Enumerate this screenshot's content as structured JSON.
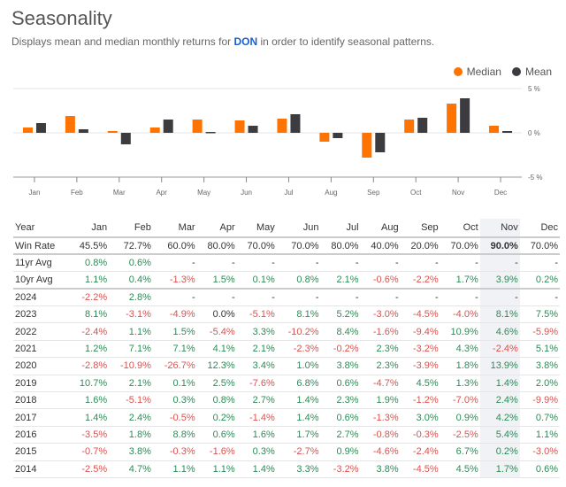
{
  "header": {
    "title": "Seasonality",
    "subtitle_prefix": "Displays mean and median monthly returns for ",
    "ticker": "DON",
    "subtitle_suffix": " in order to identify seasonal patterns."
  },
  "legend": [
    {
      "label": "Median",
      "color": "#ff7300"
    },
    {
      "label": "Mean",
      "color": "#3b3b40"
    }
  ],
  "chart_data": {
    "type": "bar",
    "categories": [
      "Jan",
      "Feb",
      "Mar",
      "Apr",
      "May",
      "Jun",
      "Jul",
      "Aug",
      "Sep",
      "Oct",
      "Nov",
      "Dec"
    ],
    "series": [
      {
        "name": "Median",
        "color": "#ff7300",
        "values": [
          0.6,
          1.9,
          0.2,
          0.6,
          1.5,
          1.4,
          1.6,
          -1.0,
          -2.8,
          1.5,
          3.3,
          0.8
        ]
      },
      {
        "name": "Mean",
        "color": "#3b3b40",
        "values": [
          1.1,
          0.4,
          -1.3,
          1.5,
          0.1,
          0.8,
          2.1,
          -0.6,
          -2.2,
          1.7,
          3.9,
          0.2
        ]
      }
    ],
    "ylim": [
      -5,
      5
    ],
    "yticks": [
      "5 %",
      "0 %",
      "-5 %"
    ],
    "ytick_values": [
      5,
      0,
      -5
    ],
    "legend_position": "top-right",
    "grid": true
  },
  "table": {
    "highlight_column": "Nov",
    "headers": [
      "Year",
      "Jan",
      "Feb",
      "Mar",
      "Apr",
      "May",
      "Jun",
      "Jul",
      "Aug",
      "Sep",
      "Oct",
      "Nov",
      "Dec"
    ],
    "rows": [
      {
        "label": "Win Rate",
        "kind": "winrate",
        "cells": [
          "45.5%",
          "72.7%",
          "60.0%",
          "80.0%",
          "70.0%",
          "70.0%",
          "80.0%",
          "40.0%",
          "20.0%",
          "70.0%",
          "90.0%",
          "70.0%"
        ]
      },
      {
        "label": "11yr Avg",
        "kind": "avg11",
        "cells": [
          "0.8%",
          "0.6%",
          "-",
          "-",
          "-",
          "-",
          "-",
          "-",
          "-",
          "-",
          "-",
          "-"
        ]
      },
      {
        "label": "10yr Avg",
        "kind": "avg10",
        "cells": [
          "1.1%",
          "0.4%",
          "-1.3%",
          "1.5%",
          "0.1%",
          "0.8%",
          "2.1%",
          "-0.6%",
          "-2.2%",
          "1.7%",
          "3.9%",
          "0.2%"
        ]
      },
      {
        "label": "2024",
        "kind": "year",
        "cells": [
          "-2.2%",
          "2.8%",
          "-",
          "-",
          "-",
          "-",
          "-",
          "-",
          "-",
          "-",
          "-",
          "-"
        ]
      },
      {
        "label": "2023",
        "kind": "year",
        "cells": [
          "8.1%",
          "-3.1%",
          "-4.9%",
          "0.0%",
          "-5.1%",
          "8.1%",
          "5.2%",
          "-3.0%",
          "-4.5%",
          "-4.0%",
          "8.1%",
          "7.5%"
        ]
      },
      {
        "label": "2022",
        "kind": "year",
        "cells": [
          "-2.4%",
          "1.1%",
          "1.5%",
          "-5.4%",
          "3.3%",
          "-10.2%",
          "8.4%",
          "-1.6%",
          "-9.4%",
          "10.9%",
          "4.6%",
          "-5.9%"
        ]
      },
      {
        "label": "2021",
        "kind": "year",
        "cells": [
          "1.2%",
          "7.1%",
          "7.1%",
          "4.1%",
          "2.1%",
          "-2.3%",
          "-0.2%",
          "2.3%",
          "-3.2%",
          "4.3%",
          "-2.4%",
          "5.1%"
        ]
      },
      {
        "label": "2020",
        "kind": "year",
        "cells": [
          "-2.8%",
          "-10.9%",
          "-26.7%",
          "12.3%",
          "3.4%",
          "1.0%",
          "3.8%",
          "2.3%",
          "-3.9%",
          "1.8%",
          "13.9%",
          "3.8%"
        ]
      },
      {
        "label": "2019",
        "kind": "year",
        "cells": [
          "10.7%",
          "2.1%",
          "0.1%",
          "2.5%",
          "-7.6%",
          "6.8%",
          "0.6%",
          "-4.7%",
          "4.5%",
          "1.3%",
          "1.4%",
          "2.0%"
        ]
      },
      {
        "label": "2018",
        "kind": "year",
        "cells": [
          "1.6%",
          "-5.1%",
          "0.3%",
          "0.8%",
          "2.7%",
          "1.4%",
          "2.3%",
          "1.9%",
          "-1.2%",
          "-7.0%",
          "2.4%",
          "-9.9%"
        ]
      },
      {
        "label": "2017",
        "kind": "year",
        "cells": [
          "1.4%",
          "2.4%",
          "-0.5%",
          "0.2%",
          "-1.4%",
          "1.4%",
          "0.6%",
          "-1.3%",
          "3.0%",
          "0.9%",
          "4.2%",
          "0.7%"
        ]
      },
      {
        "label": "2016",
        "kind": "year",
        "cells": [
          "-3.5%",
          "1.8%",
          "8.8%",
          "0.6%",
          "1.6%",
          "1.7%",
          "2.7%",
          "-0.8%",
          "-0.3%",
          "-2.5%",
          "5.4%",
          "1.1%"
        ]
      },
      {
        "label": "2015",
        "kind": "year",
        "cells": [
          "-0.7%",
          "3.8%",
          "-0.3%",
          "-1.6%",
          "0.3%",
          "-2.7%",
          "0.9%",
          "-4.6%",
          "-2.4%",
          "6.7%",
          "0.2%",
          "-3.0%"
        ]
      },
      {
        "label": "2014",
        "kind": "year",
        "cells": [
          "-2.5%",
          "4.7%",
          "1.1%",
          "1.1%",
          "1.4%",
          "3.3%",
          "-3.2%",
          "3.8%",
          "-4.5%",
          "4.5%",
          "1.7%",
          "0.6%"
        ]
      }
    ]
  }
}
